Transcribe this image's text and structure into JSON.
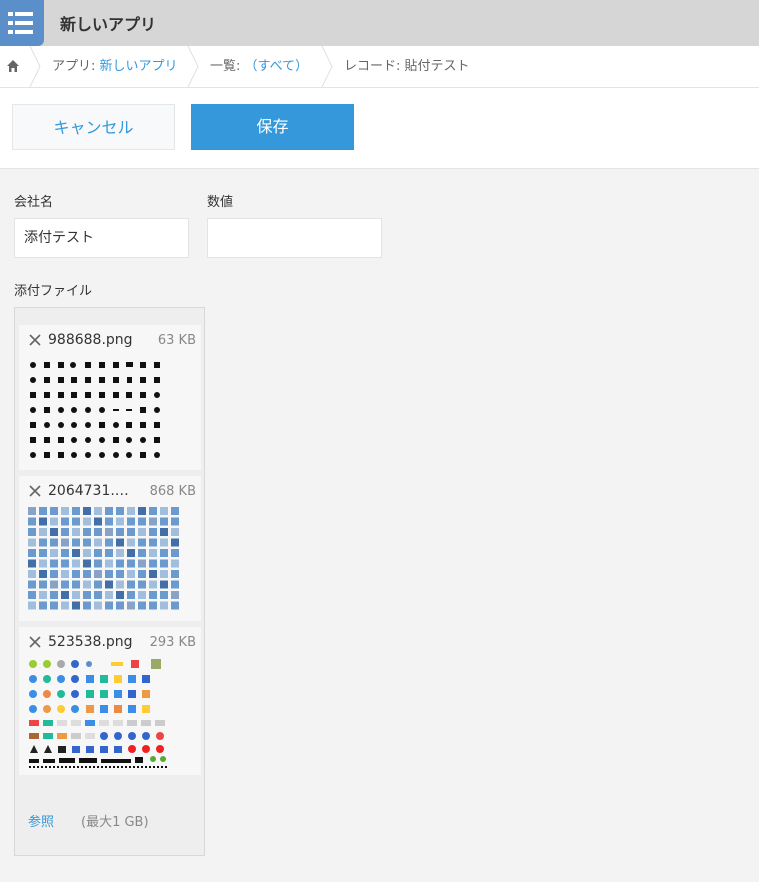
{
  "app": {
    "title": "新しいアプリ"
  },
  "breadcrumb": {
    "app_prefix": "アプリ: ",
    "app_link": "新しいアプリ",
    "list_prefix": "一覧: ",
    "list_link": "（すべて）",
    "record": "レコード: 貼付テスト"
  },
  "toolbar": {
    "cancel_label": "キャンセル",
    "save_label": "保存"
  },
  "form": {
    "company": {
      "label": "会社名",
      "value": "添付テスト"
    },
    "number": {
      "label": "数値",
      "value": ""
    },
    "attachments": {
      "label": "添付ファイル",
      "files": [
        {
          "name": "988688.png",
          "size": "63 KB"
        },
        {
          "name": "2064731.…",
          "size": "868 KB"
        },
        {
          "name": "523538.png",
          "size": "293 KB"
        }
      ],
      "browse_label": "参照",
      "limit_text": "(最大1 GB)"
    }
  },
  "colors": {
    "accent": "#3498db",
    "app_icon": "#5b8fc9"
  },
  "icons": {
    "app": "list-icon",
    "home": "home-icon",
    "remove": "close-icon"
  }
}
